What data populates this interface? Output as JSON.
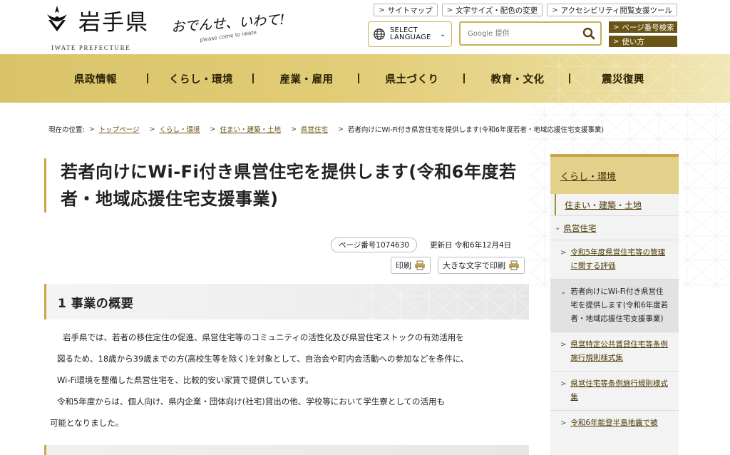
{
  "header": {
    "logo_title": "岩手県",
    "logo_sub": "IWATE PREFECTURE",
    "slogan_main": "おでんせ、いわて!",
    "slogan_sub": "please come to iwate",
    "top_links": [
      "サイトマップ",
      "文字サイズ・配色の変更",
      "アクセシビリティ閲覧支援ツール"
    ],
    "language_label": "SELECT LANGUAGE",
    "search_placeholder": "Google 提供",
    "page_number_search": "ページ番号検索",
    "how_to_use": "使い方"
  },
  "nav": {
    "items": [
      "県政情報",
      "くらし・環境",
      "産業・雇用",
      "県土づくり",
      "教育・文化",
      "震災復興"
    ]
  },
  "breadcrumb": {
    "prefix": "現在の位置:",
    "links": [
      "トップページ",
      "くらし・環境",
      "住まい・建築・土地",
      "県営住宅"
    ],
    "current": "若者向けにWi-Fi付き県営住宅を提供します(令和6年度若者・地域応援住宅支援事業)"
  },
  "page": {
    "title": "若者向けにWi-Fi付き県営住宅を提供します(令和6年度若者・地域応援住宅支援事業)",
    "page_number": "ページ番号1074630",
    "updated": "更新日 令和6年12月4日",
    "print_label": "印刷",
    "print_large_label": "大きな文字で印刷",
    "section1_title": "1 事業の概要",
    "body": [
      "岩手県では、若者の移住定住の促進、県営住宅等のコミュニティの活性化及び県営住宅ストックの有効活用を",
      "図るため、18歳から39歳までの方(高校生等を除く)を対象として、自治会や町内会活動への参加などを条件に、",
      "Wi-Fi環境を整備した県営住宅を、比較的安い家賃で提供しています。",
      "令和5年度からは、個人向け、県内企業・団体向け(社宅)貸出の他、学校等において学生寮としての活用も",
      "可能となりました。"
    ]
  },
  "sidebar": {
    "head": "くらし・環境",
    "level2": "住まい・建築・土地",
    "level3": "県営住宅",
    "items": [
      "令和5年度県営住宅等の管理に関する評価",
      "若者向けにWi-Fi付き県営住宅を提供します(令和6年度若者・地域応援住宅支援事業)",
      "県営特定公共賃貸住宅等条例施行規則様式集",
      "県営住宅等条例施行規則様式集",
      "令和6年能登半島地震で被"
    ],
    "current_index": 1
  },
  "colors": {
    "gold": "#c9a449",
    "nav_gold": "#e2cd78",
    "dark_brown": "#6a5517"
  }
}
